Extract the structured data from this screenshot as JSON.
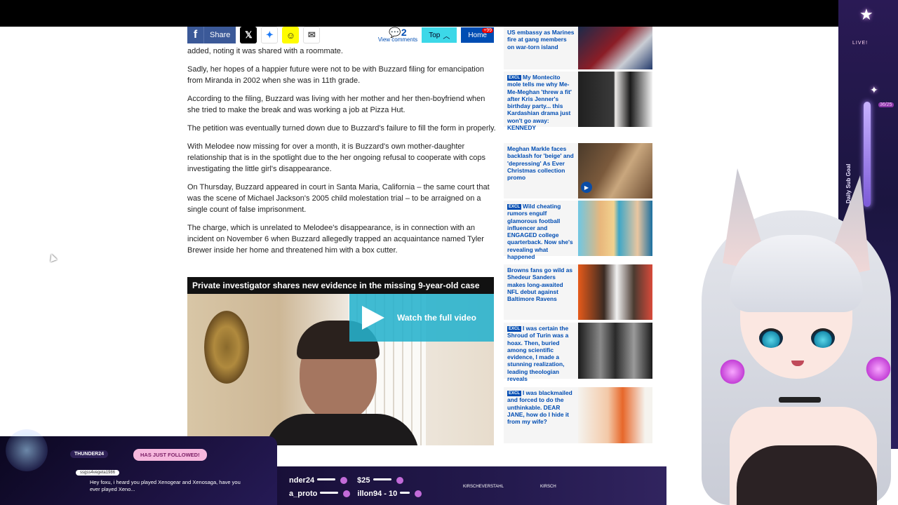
{
  "share_bar": {
    "share_label": "Share",
    "comments_count": "2",
    "comments_label": "View comments",
    "top_label": "Top",
    "home_label": "Home",
    "home_badge": "+99"
  },
  "article": {
    "paragraphs": [
      "added, noting it was shared with a roommate.",
      "Sadly, her hopes of a happier future were not to be with Buzzard filing for emancipation from Miranda in 2002 when she was in 11th grade.",
      "According to the filing, Buzzard was living with her mother and her then-boyfriend when she tried to make the break and was working a job at Pizza Hut.",
      "The petition was eventually turned down due to Buzzard's failure to fill the form in properly.",
      "With Melodee now missing for over a month, it is Buzzard's own mother-daughter relationship that is in the spotlight due to the her ongoing refusal to cooperate with cops investigating the little girl's disappearance.",
      "On Thursday, Buzzard appeared in court in Santa Maria, California – the same court that was the scene of Michael Jackson's 2005 child molestation trial – to be arraigned on a single count of false imprisonment.",
      "The charge, which is unrelated to Melodee's disappearance, is in connection with an incident on November 6 when Buzzard allegedly trapped an acquaintance named Tyler Brewer inside her home and threatened him with a box cutter."
    ]
  },
  "video": {
    "title": "Private investigator shares new evidence in the missing 9-year-old case",
    "watch_label": "Watch the full video"
  },
  "sidebar": {
    "items": [
      {
        "tag": "",
        "text": "US embassy as Marines fire at gang members on war-torn island"
      },
      {
        "tag": "EXCLUSIVE",
        "text": "My Montecito mole tells me why Me-Me-Meghan 'threw a fit' after Kris Jenner's birthday party... this Kardashian drama just won't go away: KENNEDY"
      },
      {
        "tag": "",
        "text": "Meghan Markle faces backlash for 'beige' and 'depressing' As Ever Christmas collection promo"
      },
      {
        "tag": "EXCLUSIVE",
        "text": "Wild cheating rumors engulf glamorous football influencer and ENGAGED college quarterback. Now she's revealing what happened"
      },
      {
        "tag": "",
        "text": "Browns fans go wild as Shedeur Sanders makes long-awaited NFL debut against Baltimore Ravens"
      },
      {
        "tag": "EXCLUSIVE",
        "text": "I was certain the Shroud of Turin was a hoax. Then, buried among scientific evidence, I made a stunning realization, leading theologian reveals"
      },
      {
        "tag": "EXCLUSIVE",
        "text": "I was blackmailed and forced to do the unthinkable. DEAR JANE, how do I hide it from my wife?"
      }
    ]
  },
  "stream": {
    "live_label": "LIVE!",
    "goal_label": "Daily Sub Goal",
    "goal_count": "36/25",
    "follower_name": "THUNDER24",
    "follow_text": "HAS JUST FOLLOWED!",
    "chat_user": "ssgss4vegeta1986",
    "chat_message": "Hey foxu, i heard you played Xenogear and Xenosaga, have you ever played Xeno...",
    "ticker_row1": [
      "nder24",
      "$25"
    ],
    "ticker_row2": [
      "a_proto",
      "illon94 - 10"
    ],
    "ticker_names": [
      "KIRSCHEVERSTAHL",
      "KIRSCH"
    ]
  },
  "colors": {
    "dm_blue": "#004db3",
    "facebook": "#3b5998",
    "top_cyan": "#3cd8e8",
    "stream_purple": "#241a4e"
  }
}
